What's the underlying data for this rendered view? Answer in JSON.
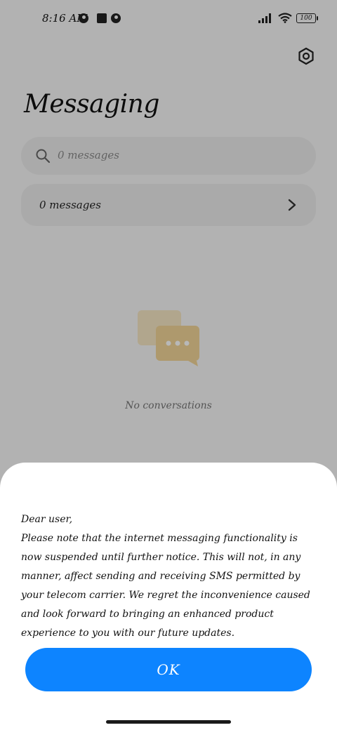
{
  "status_bar": {
    "time": "8:16 AM",
    "battery": "100"
  },
  "header": {
    "title": "Messaging"
  },
  "search": {
    "placeholder": "0 messages"
  },
  "messages_row": {
    "label": "0 messages"
  },
  "empty_state": {
    "text": "No conversations"
  },
  "dialog": {
    "greeting": "Dear user,",
    "body": "Please note that the internet messaging functionality is now suspended until further notice. This will not, in any manner, affect sending and receiving SMS permitted by your telecom carrier. We regret the inconvenience caused and look forward to bringing an enhanced product experience to you with our future updates.",
    "ok_label": "OK"
  },
  "colors": {
    "accent": "#0d84ff",
    "illustration": "#f2d597"
  },
  "icons": [
    "settings-icon",
    "search-icon",
    "chevron-right-icon",
    "chat-bubbles-icon",
    "signal-icon",
    "wifi-icon",
    "battery-icon"
  ]
}
